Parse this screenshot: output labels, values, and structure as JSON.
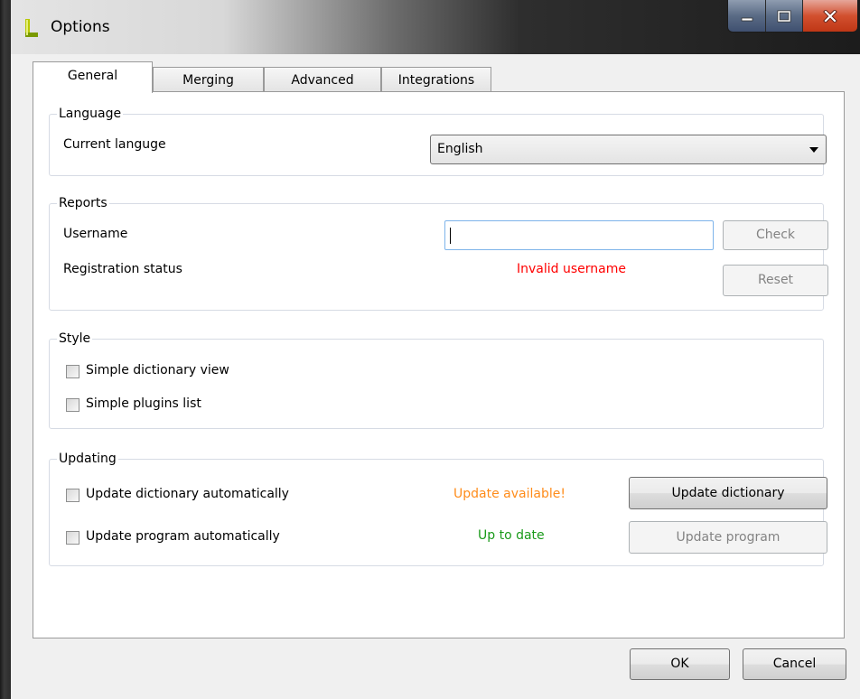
{
  "window": {
    "title": "Options",
    "logo_icon": "app-logo-icon",
    "caption": {
      "minimize_icon": "minimize-icon",
      "maximize_icon": "maximize-icon",
      "close_icon": "close-icon"
    }
  },
  "tabs": [
    {
      "label": "General",
      "active": true
    },
    {
      "label": "Merging",
      "active": false
    },
    {
      "label": "Advanced",
      "active": false
    },
    {
      "label": "Integrations",
      "active": false
    }
  ],
  "language": {
    "group_title": "Language",
    "current_label": "Current languge",
    "selected": "English"
  },
  "reports": {
    "group_title": "Reports",
    "username_label": "Username",
    "username_value": "",
    "check_label": "Check",
    "registration_label": "Registration status",
    "registration_status": "Invalid username",
    "reset_label": "Reset"
  },
  "style": {
    "group_title": "Style",
    "simple_dictionary_view": {
      "label": "Simple dictionary view",
      "checked": false
    },
    "simple_plugins_list": {
      "label": "Simple plugins list",
      "checked": false
    }
  },
  "updating": {
    "group_title": "Updating",
    "dictionary_auto": {
      "label": "Update dictionary automatically",
      "checked": false
    },
    "dictionary_status": "Update available!",
    "update_dictionary_label": "Update dictionary",
    "program_auto": {
      "label": "Update program automatically",
      "checked": false
    },
    "program_status": "Up to date",
    "update_program_label": "Update program"
  },
  "footer": {
    "ok_label": "OK",
    "cancel_label": "Cancel"
  },
  "colors": {
    "error": "#ff0000",
    "warning": "#ff8c1a",
    "ok": "#1a9a1a",
    "focus_border": "#7eb4ea"
  }
}
